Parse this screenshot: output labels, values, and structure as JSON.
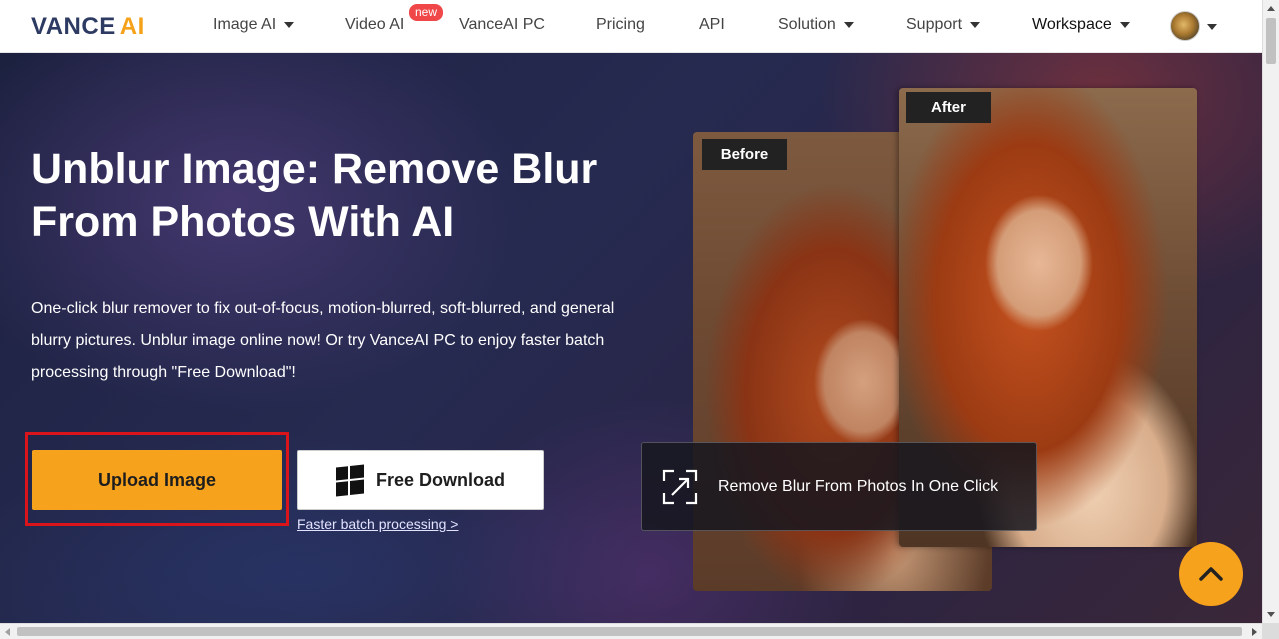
{
  "logo": {
    "part1": "VANCE",
    "part2": "AI"
  },
  "nav": {
    "items": [
      {
        "label": "Image AI",
        "dropdown": true
      },
      {
        "label": "Video AI",
        "dropdown": false
      },
      {
        "label": "VanceAI PC",
        "dropdown": false
      },
      {
        "label": "Pricing",
        "dropdown": false
      },
      {
        "label": "API",
        "dropdown": false
      },
      {
        "label": "Solution",
        "dropdown": true
      },
      {
        "label": "Support",
        "dropdown": true
      },
      {
        "label": "Workspace",
        "dropdown": true
      }
    ],
    "new_badge": "new"
  },
  "hero": {
    "title": "Unblur Image: Remove Blur From Photos With AI",
    "description": "One-click blur remover to fix out-of-focus, motion-blurred, soft-blurred, and general blurry pictures. Unblur image online now! Or try VanceAI PC to enjoy faster batch processing through \"Free Download\"!",
    "upload_label": "Upload Image",
    "download_label": "Free Download",
    "batch_link": "Faster batch processing >"
  },
  "comparison": {
    "before_label": "Before",
    "after_label": "After",
    "feature_text": "Remove Blur From Photos In One Click"
  },
  "colors": {
    "accent": "#f7a21c",
    "logo_dark": "#2d3b63",
    "badge_red": "#f04848",
    "highlight_red": "#d9141b"
  },
  "icons": {
    "download_button": "windows-icon",
    "feature_box": "expand-icon",
    "scroll_top": "chevron-up-icon"
  }
}
